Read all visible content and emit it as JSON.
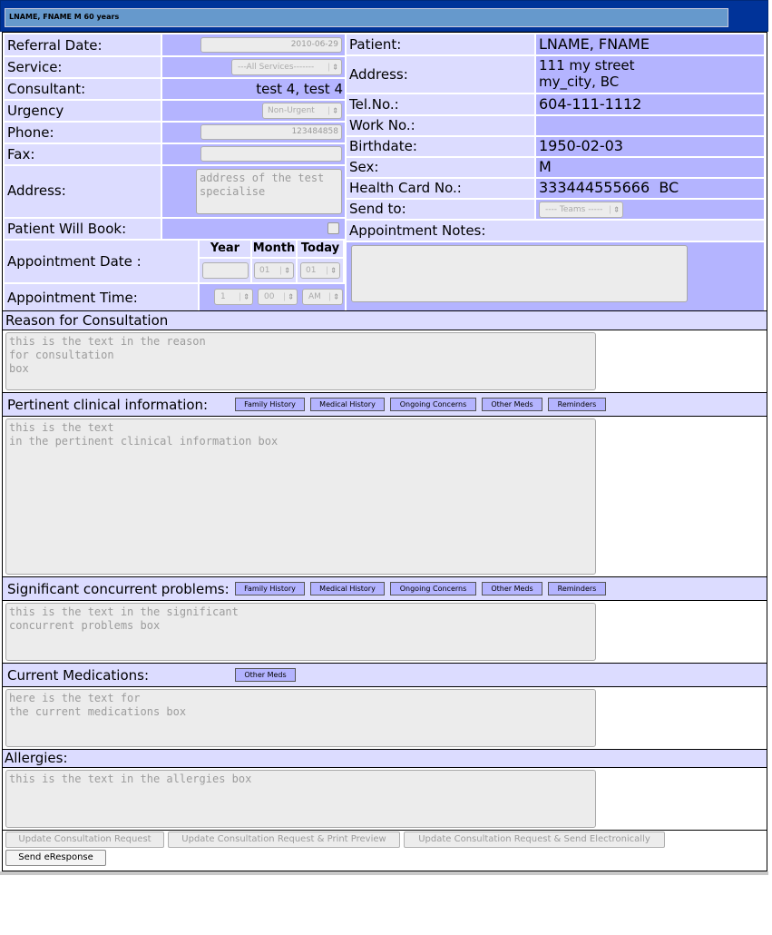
{
  "header": {
    "title": "LNAME, FNAME M 60 years"
  },
  "referral": {
    "referral_date_label": "Referral Date:",
    "referral_date_value": "2010-06-29",
    "service_label": "Service:",
    "service_value": "---All Services-------",
    "consultant_label": "Consultant:",
    "consultant_value": "test 4, test 4",
    "urgency_label": "Urgency",
    "urgency_value": "Non-Urgent",
    "phone_label": "Phone:",
    "phone_value": "123484858",
    "fax_label": "Fax:",
    "fax_value": "",
    "address_label": "Address:",
    "address_value": "address of the test\nspecialise",
    "patient_will_book_label": "Patient Will Book:",
    "appt_date_label": "Appointment Date :",
    "year_header": "Year",
    "month_header": "Month",
    "today_header": "Today",
    "year_value": "",
    "month_value": "01",
    "day_value": "01",
    "appt_time_label": "Appointment Time:",
    "hour_value": "1",
    "minute_value": "00",
    "ampm_value": "AM"
  },
  "patient": {
    "patient_label": "Patient:",
    "patient_value": "LNAME, FNAME",
    "address_label": "Address:",
    "address_line1": "111 my street",
    "address_line2": "my_city, BC",
    "tel_label": "Tel.No.:",
    "tel_value": "604-111-1112",
    "work_label": "Work No.:",
    "work_value": "",
    "birthdate_label": "Birthdate:",
    "birthdate_value": "1950-02-03",
    "sex_label": "Sex:",
    "sex_value": "M",
    "hc_label": "Health Card No.:",
    "hc_value": "333444555666  BC",
    "sendto_label": "Send to:",
    "sendto_value": "---- Teams -----",
    "notes_label": "Appointment Notes:",
    "notes_value": ""
  },
  "sections": {
    "reason_label": "Reason for Consultation",
    "reason_text": "this is the text in the reason\nfor consultation\nbox",
    "clinical_label": "Pertinent clinical information:",
    "clinical_text": "this is the text\nin the pertinent clinical information box",
    "concurrent_label": "Significant concurrent problems:",
    "concurrent_text": "this is the text in the significant\nconcurrent problems box",
    "meds_label": "Current Medications:",
    "meds_text": "here is the text for\nthe current medications box",
    "allergies_label": "Allergies:",
    "allergies_text": "this is the text in the allergies box"
  },
  "buttons": {
    "family_history": "Family History",
    "medical_history": "Medical History",
    "ongoing_concerns": "Ongoing Concerns",
    "other_meds": "Other Meds",
    "reminders": "Reminders",
    "update": "Update Consultation Request",
    "update_print": "Update Consultation Request & Print Preview",
    "update_send": "Update Consultation Request & Send Electronically",
    "send_eresponse": "Send eResponse"
  }
}
